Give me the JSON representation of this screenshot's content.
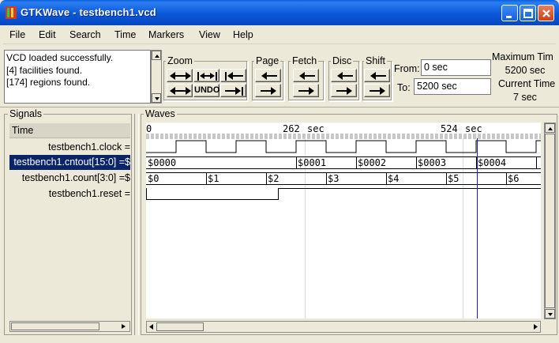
{
  "window": {
    "title": "GTKWave - testbench1.vcd"
  },
  "menu": [
    "File",
    "Edit",
    "Search",
    "Time",
    "Markers",
    "View",
    "Help"
  ],
  "log": [
    "VCD loaded successfully.",
    "[4] facilities found.",
    "[174] regions found."
  ],
  "toolbar": {
    "zoom_label": "Zoom",
    "undo_label": "UNDO",
    "page_label": "Page",
    "fetch_label": "Fetch",
    "disc_label": "Disc",
    "shift_label": "Shift"
  },
  "time_range": {
    "from_label": "From:",
    "from_value": "0 sec",
    "to_label": "To:",
    "to_value": "5200 sec",
    "max_time_label": "Maximum Tim",
    "max_time_value": "5200 sec",
    "current_time_label": "Current Time",
    "current_time_value": "7 sec"
  },
  "signals": {
    "pane_title": "Signals",
    "header": "Time",
    "rows": [
      {
        "name": "testbench1.clock =",
        "selected": false
      },
      {
        "name": "testbench1.cntout[15:0] =$",
        "selected": true
      },
      {
        "name": "testbench1.count[3:0] =$",
        "selected": false
      },
      {
        "name": "testbench1.reset =",
        "selected": false
      }
    ]
  },
  "waves": {
    "pane_title": "Waves",
    "time_labels": [
      "0",
      "262",
      "sec",
      "524",
      "sec"
    ],
    "cntout_values": [
      "$0000",
      "$0001",
      "$0002",
      "$0003",
      "$0004"
    ],
    "count_values": [
      "$0",
      "$1",
      "$2",
      "$3",
      "$4",
      "$5",
      "$6"
    ]
  },
  "colors": {
    "marker": "#1c1cb0",
    "selection": "#0a246a",
    "titlebar": "#0a58d8"
  }
}
